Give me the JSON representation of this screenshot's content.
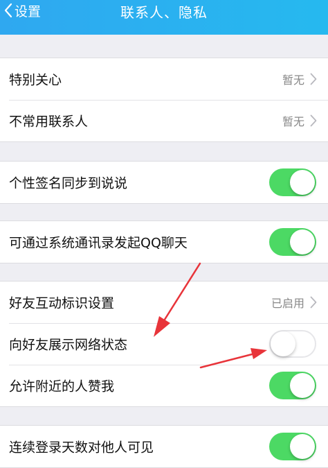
{
  "navbar": {
    "back_label": "设置",
    "title": "联系人、隐私"
  },
  "sections": [
    {
      "rows": [
        {
          "label": "特别关心",
          "value": "暂无",
          "type": "link"
        },
        {
          "label": "不常用联系人",
          "value": "暂无",
          "type": "link"
        }
      ]
    },
    {
      "rows": [
        {
          "label": "个性签名同步到说说",
          "type": "toggle",
          "on": true
        }
      ]
    },
    {
      "rows": [
        {
          "label": "可通过系统通讯录发起QQ聊天",
          "type": "toggle",
          "on": true
        }
      ]
    },
    {
      "rows": [
        {
          "label": "好友互动标识设置",
          "value": "已启用",
          "type": "link"
        },
        {
          "label": "向好友展示网络状态",
          "type": "toggle",
          "on": false
        },
        {
          "label": "允许附近的人赞我",
          "type": "toggle",
          "on": true
        }
      ]
    },
    {
      "rows": [
        {
          "label": "连续登录天数对他人可见",
          "type": "toggle",
          "on": true
        }
      ]
    }
  ],
  "colors": {
    "navbar": "#2fa8f0",
    "toggle_on": "#4cd964",
    "annotation_arrow": "#e8343a"
  }
}
